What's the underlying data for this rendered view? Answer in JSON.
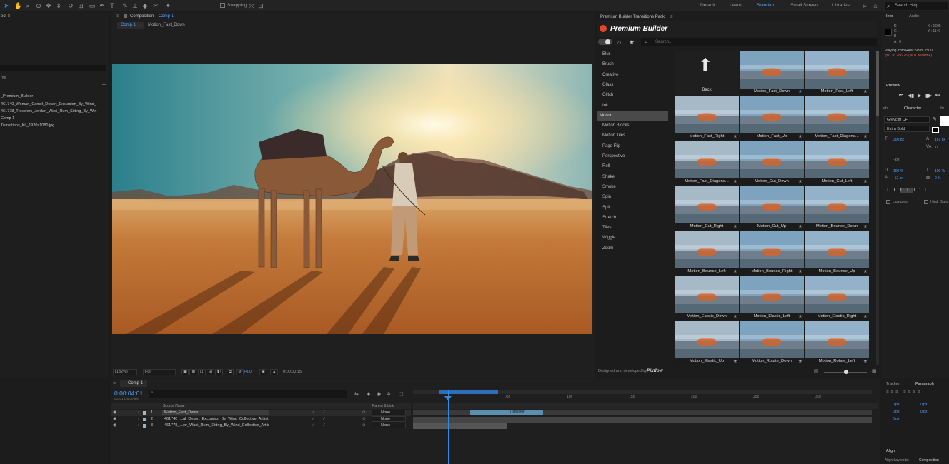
{
  "toolbar": {
    "snapping_label": "Snapping",
    "workspaces": [
      "Default",
      "Learn",
      "Standard",
      "Small Screen",
      "Libraries"
    ],
    "active_workspace": "Standard",
    "search_placeholder": "Search Help"
  },
  "project_panel": {
    "title_fragment": "ect ≡",
    "section_title": "me",
    "items": [
      "_Premium_Builder",
      "461740_Woman_Camel_Desert_Excursion_By_Wind_",
      "461778_Travelers_Jordan_Wadi_Rum_Sitting_By_Win",
      "Comp 1",
      "Transitions_Kit_1920x1080.jpg"
    ]
  },
  "composition_panel": {
    "title_prefix": "Composition",
    "title_comp": "Comp 1",
    "tabs": [
      "Comp 1",
      "Motion_Fast_Down"
    ],
    "zoom": "(132%)",
    "resolution": "Full",
    "exposure": "+0.0",
    "timecode": "0;00;00;15"
  },
  "premium_builder": {
    "panel_title": "Premium Builder Transitions Pack",
    "brand": "Premium Builder",
    "search_placeholder": "Search...",
    "categories": [
      "Blur",
      "Brush",
      "Creative",
      "Glass",
      "Glitch",
      "Ink",
      "Motion",
      "Motion Blocks",
      "Motion Tiles",
      "Page Flip",
      "Perspective",
      "Roll",
      "Shake",
      "Smoke",
      "Spin",
      "Split",
      "Stretch",
      "Tiles",
      "Wiggle",
      "Zoom"
    ],
    "active_category": "Motion",
    "back_label": "Back",
    "thumbnails": [
      {
        "label": "Motion_Fast_Down",
        "starred": true
      },
      {
        "label": "Motion_Fast_Left",
        "starred": false
      },
      {
        "label": "Motion_Fast_Right",
        "starred": false
      },
      {
        "label": "Motion_Fast_Up",
        "starred": false
      },
      {
        "label": "Motion_Fast_Diagona...",
        "starred": false
      },
      {
        "label": "Motion_Fast_Diagona...",
        "starred": false
      },
      {
        "label": "Motion_Cut_Down",
        "starred": false
      },
      {
        "label": "Motion_Cut_Left",
        "starred": false
      },
      {
        "label": "Motion_Cut_Right",
        "starred": false
      },
      {
        "label": "Motion_Cut_Up",
        "starred": false
      },
      {
        "label": "Motion_Bounce_Down",
        "starred": false
      },
      {
        "label": "Motion_Bounce_Left",
        "starred": false
      },
      {
        "label": "Motion_Bounce_Right",
        "starred": false
      },
      {
        "label": "Motion_Bounce_Up",
        "starred": false
      },
      {
        "label": "Motion_Elastic_Down",
        "starred": false
      },
      {
        "label": "Motion_Elastic_Left",
        "starred": false
      },
      {
        "label": "Motion_Elastic_Right",
        "starred": false
      },
      {
        "label": "Motion_Elastic_Up",
        "starred": false
      },
      {
        "label": "Motion_Rotate_Down",
        "starred": false
      },
      {
        "label": "Motion_Rotate_Left",
        "starred": false
      }
    ],
    "footer": "Designed and developed by",
    "footer_brand": "Pixflow"
  },
  "info_panel": {
    "tabs": [
      "Info",
      "Audio"
    ],
    "rgb_labels": [
      "R :",
      "G :",
      "B :",
      "A : 0"
    ],
    "x": "X : 1605",
    "y": "Y : 1140",
    "status_line1": "Playing from RAM: 93 of 1500",
    "status_line2": "fps: 16.786/25 (NOT realtime)"
  },
  "preview_panel": {
    "title": "Preview"
  },
  "character_panel": {
    "tabs": [
      "ets",
      "Character",
      "Libr"
    ],
    "font": "Greycliff CF",
    "style": "Extra Bold",
    "size": "300 px",
    "leading": "161 px",
    "tracking": "0",
    "vertical_scale": "100 %",
    "horizontal_scale": "100 %",
    "baseline_shift": "-12 px",
    "tsume": "0 %",
    "unit": "- px",
    "ligatures": "Ligatures",
    "hindi": "Hindi Digits"
  },
  "paragraph_panel": {
    "tabs": [
      "Tracker",
      "Paragraph"
    ],
    "values": [
      "0 px",
      "0 px",
      "0 px",
      "0 px",
      "0 px"
    ]
  },
  "align_panel": {
    "title": "Align",
    "align_to": "Align Layers to:",
    "target": "Composition"
  },
  "timeline": {
    "tab": "Comp 1",
    "timecode": "0:00:04:01",
    "timecode_sub": "00101 (25.00 fps)",
    "column_source": "Source Name",
    "column_parent": "Parent & Link",
    "layers": [
      {
        "index": "1",
        "name": "Motion_Fast_Down",
        "parent": "None"
      },
      {
        "index": "2",
        "name": "461740_...al_Desert_Excursion_By_Wind_Collective_Artlist_HD.mp4",
        "parent": "None"
      },
      {
        "index": "3",
        "name": "461778_...en_Wadi_Rum_Sitting_By_Wind_Collective_Artlist_HD.mp4",
        "parent": "None"
      }
    ],
    "ruler": [
      "05s",
      "10s",
      "15s",
      "20s",
      "25s",
      "30s"
    ],
    "clip_label": "Transition"
  }
}
